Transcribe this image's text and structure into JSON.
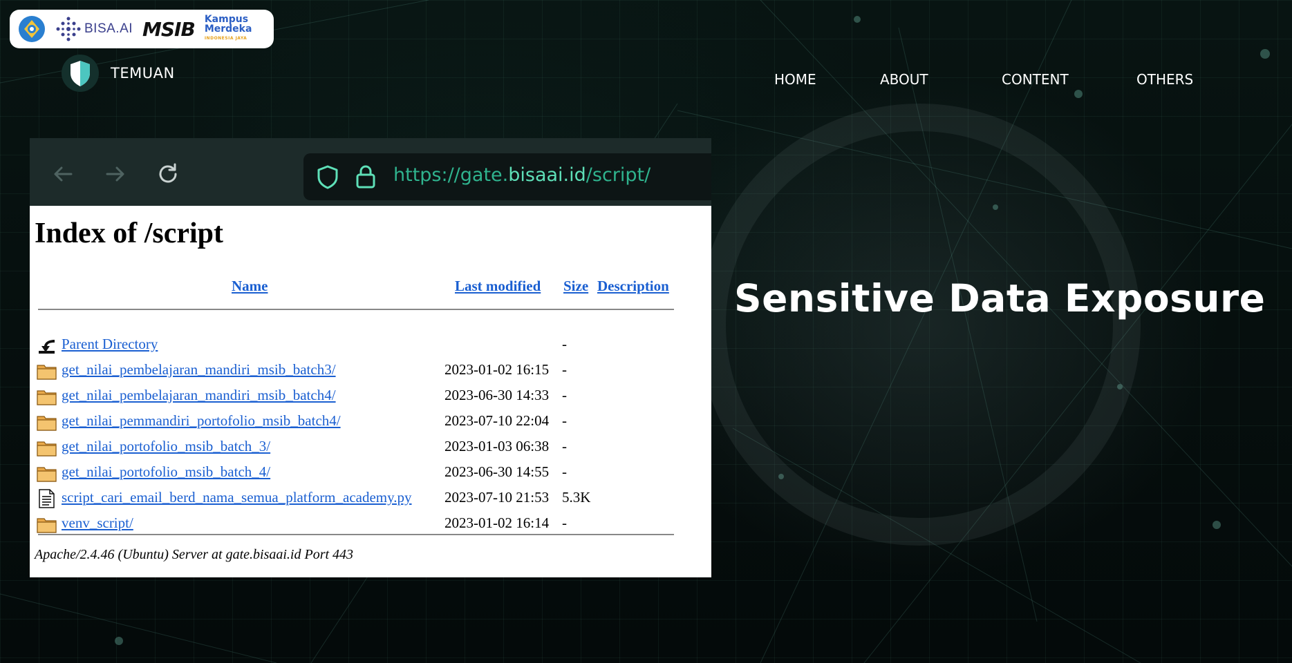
{
  "partners": {
    "bisa": "BISA.AI",
    "msib": "MSIB",
    "kampus_merdeka_1": "Kampus",
    "kampus_merdeka_2": "Merdeka",
    "kampus_merdeka_3": "INDONESIA JAYA"
  },
  "brand": {
    "name": "TEMUAN"
  },
  "nav": {
    "items": [
      "HOME",
      "ABOUT",
      "CONTENT",
      "OTHERS"
    ]
  },
  "browser": {
    "url_prefix": "https://gate.",
    "url_host": "bisaai.id",
    "url_path": "/script/"
  },
  "listing": {
    "title": "Index of /script",
    "columns": {
      "name": "Name",
      "modified": "Last modified",
      "size": "Size",
      "description": "Description"
    },
    "rows": [
      {
        "type": "parent",
        "name": "Parent Directory",
        "date": "",
        "size": "-"
      },
      {
        "type": "folder",
        "name": "get_nilai_pembelajaran_mandiri_msib_batch3/",
        "date": "2023-01-02 16:15",
        "size": "-"
      },
      {
        "type": "folder",
        "name": "get_nilai_pembelajaran_mandiri_msib_batch4/",
        "date": "2023-06-30 14:33",
        "size": "-"
      },
      {
        "type": "folder",
        "name": "get_nilai_pemmandiri_portofolio_msib_batch4/",
        "date": "2023-07-10 22:04",
        "size": "-"
      },
      {
        "type": "folder",
        "name": "get_nilai_portofolio_msib_batch_3/",
        "date": "2023-01-03 06:38",
        "size": "-"
      },
      {
        "type": "folder",
        "name": "get_nilai_portofolio_msib_batch_4/",
        "date": "2023-06-30 14:55",
        "size": "-"
      },
      {
        "type": "file",
        "name": "script_cari_email_berd_nama_semua_platform_academy.py",
        "date": "2023-07-10 21:53",
        "size": "5.3K"
      },
      {
        "type": "folder",
        "name": "venv_script/",
        "date": "2023-01-02 16:14",
        "size": "-"
      }
    ],
    "server_signature": "Apache/2.4.46 (Ubuntu) Server at gate.bisaai.id Port 443"
  },
  "headline": "Sensitive Data Exposure",
  "colors": {
    "accent": "#2fb38e",
    "link": "#1a5fd1",
    "background": "#06100f"
  },
  "icons": {
    "tut_wuri": "tut-wuri-handayani-logo",
    "bisa": "bisa-ai-logo",
    "brand": "shield-icon",
    "back": "arrow-left-icon",
    "forward": "arrow-right-icon",
    "reload": "reload-icon",
    "tracking": "shield-icon",
    "lock": "lock-icon",
    "parent": "back-arrow-icon",
    "folder": "folder-icon",
    "file": "text-file-icon"
  }
}
